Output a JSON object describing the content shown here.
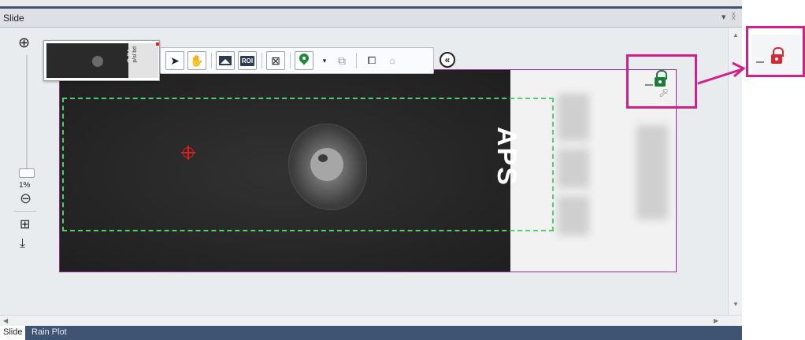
{
  "window": {
    "title": "Slide",
    "dropdown_glyph": "▾",
    "pin_glyph": "ᛝ"
  },
  "zoom": {
    "level": "1%"
  },
  "tabs": [
    {
      "label": "Slide"
    },
    {
      "label": "Rain Plot"
    }
  ],
  "slide": {
    "label_text": "APS"
  },
  "thumbnail": {
    "label_text": "APS",
    "note_text": "p/sl bd"
  },
  "toolbar": {
    "roi_label": "ROI"
  },
  "colors": {
    "scan_region": "#4fd06a",
    "callout": "#d21f8a",
    "lock_unlocked": "#1c7a3a",
    "lock_locked": "#d9282f",
    "crosshair": "#e02020"
  },
  "icons": [
    "zoom-in-icon",
    "zoom-out-icon",
    "fit-icon",
    "export-icon",
    "pointer-icon",
    "hand-icon",
    "image-icon",
    "roi-icon",
    "grid-icon",
    "pin-icon",
    "dropdown-icon",
    "duplicate-icon",
    "copy-icon",
    "lock-small-icon",
    "collapse-icon",
    "lock-unlocked-icon",
    "lock-locked-icon"
  ]
}
